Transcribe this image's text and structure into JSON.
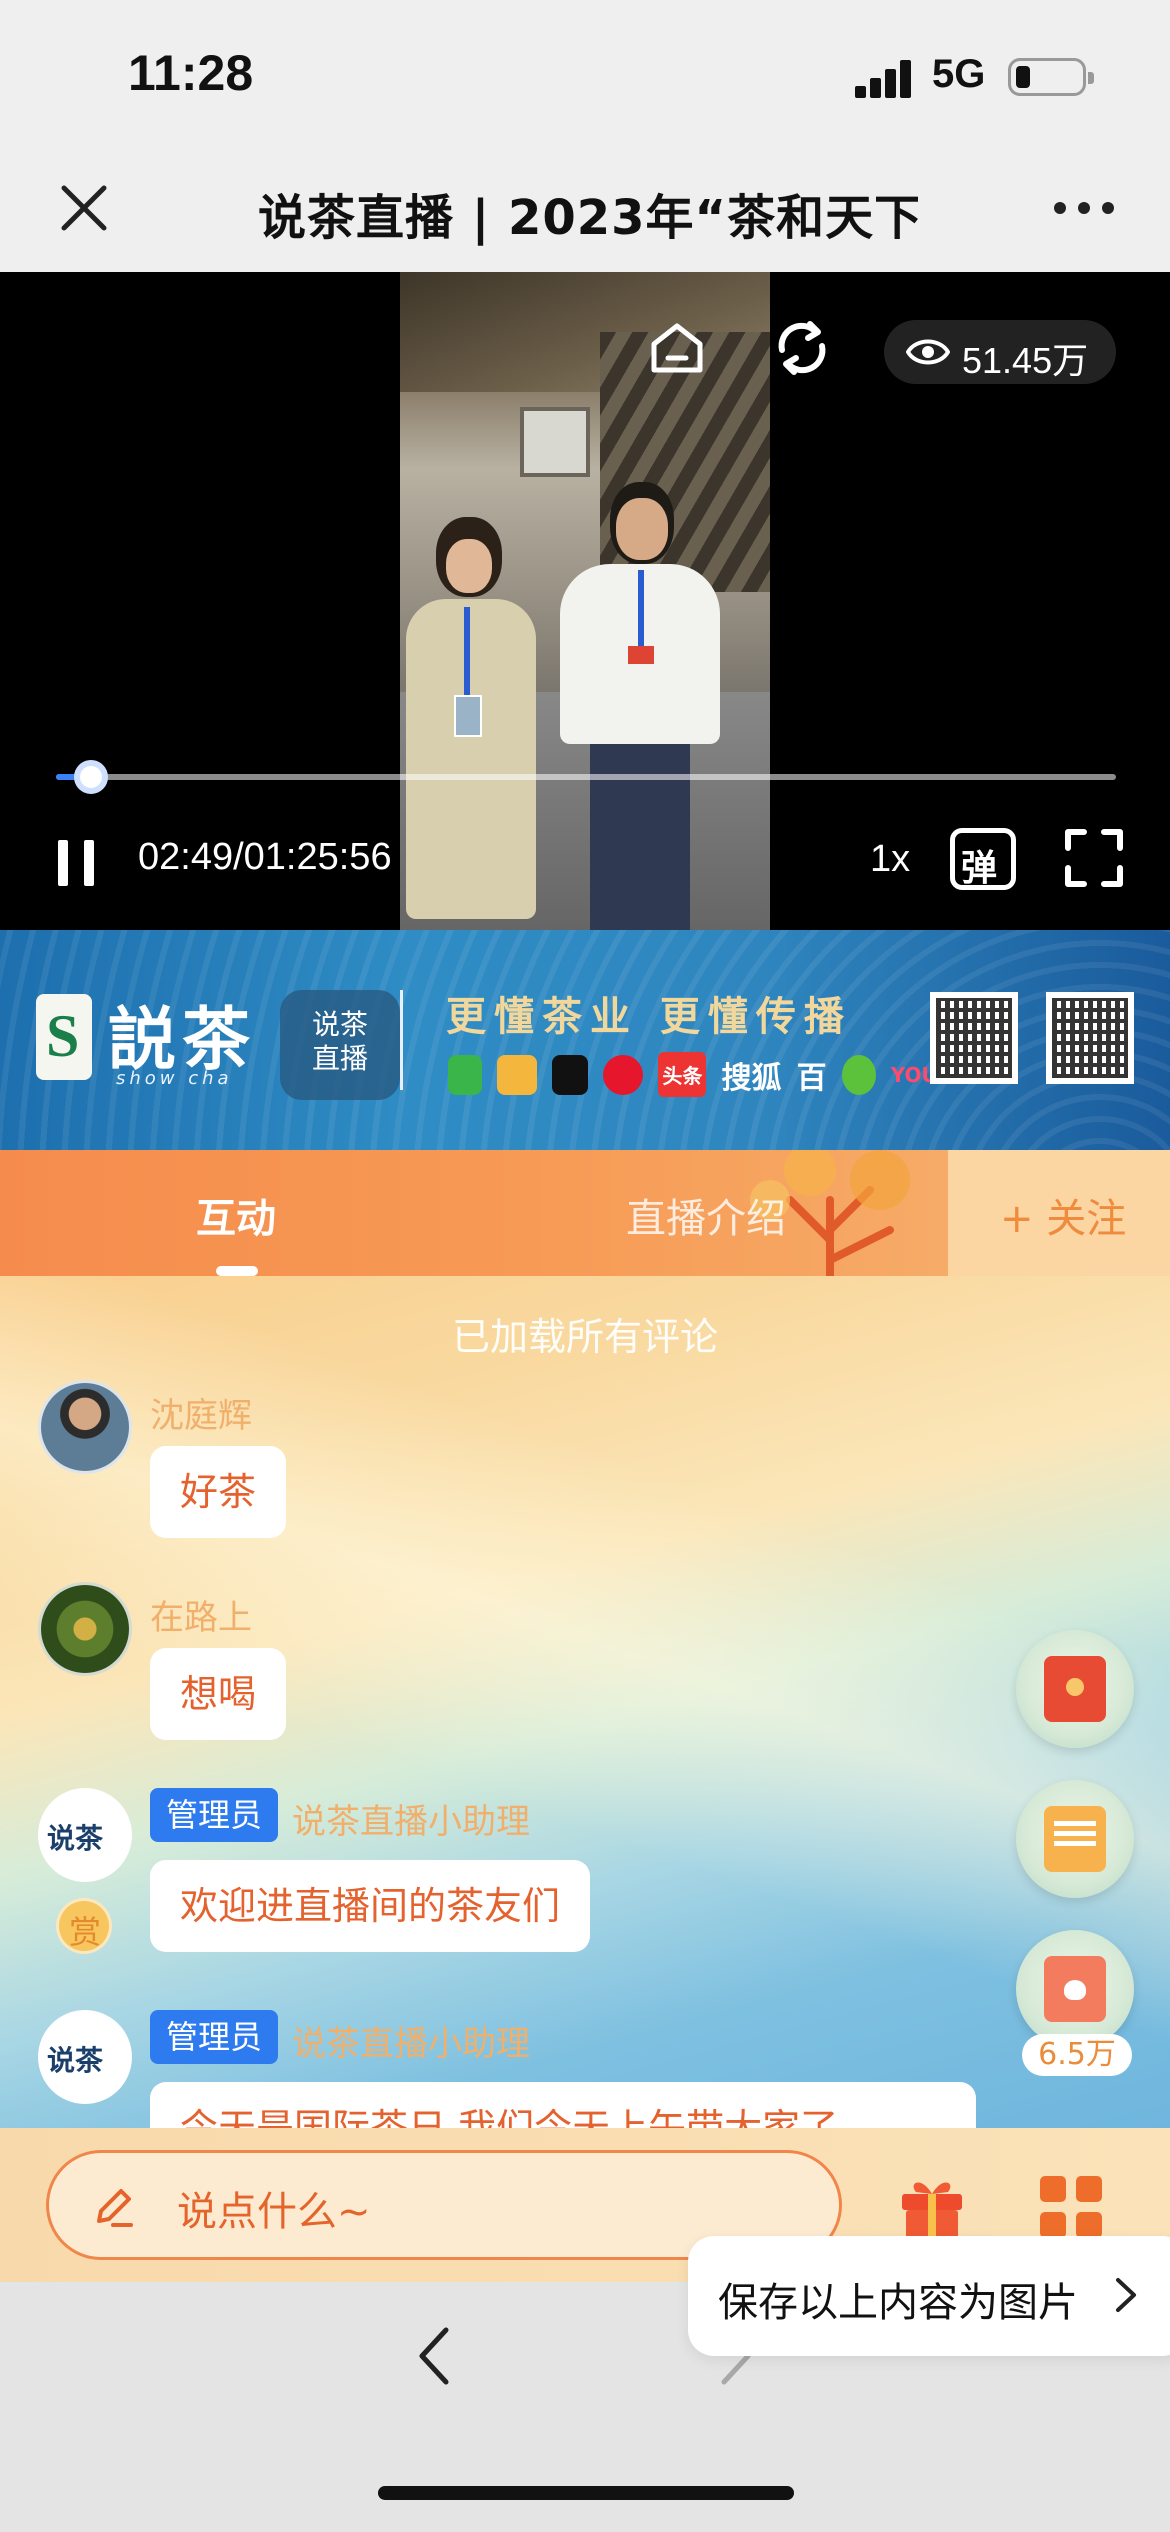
{
  "status_bar": {
    "time": "11:28",
    "network": "5G"
  },
  "navbar": {
    "title": "说茶直播 | 2023年“茶和天下"
  },
  "video": {
    "view_count": "51.45万",
    "current_time": "02:49",
    "separator": "/",
    "duration": "01:25:56",
    "progress_fraction": 0.033,
    "speed_label": "1x",
    "danmu_label": "弹"
  },
  "banner": {
    "brand": "説茶",
    "brand_sub": "show cha",
    "seal_text": "说茶 直播",
    "slogan": "更懂茶业 更懂传播",
    "platform_texts": [
      "头条",
      "搜狐",
      "百",
      "YOUKU"
    ]
  },
  "tabs": {
    "items": [
      {
        "label": "互动",
        "active": true
      },
      {
        "label": "直播介绍",
        "active": false
      }
    ],
    "follow_label": "+ 关注"
  },
  "chat": {
    "loaded_notice": "已加载所有评论",
    "messages": [
      {
        "nickname": "沈庭辉",
        "text": "好茶"
      },
      {
        "nickname": "在路上",
        "text": "想喝"
      },
      {
        "badge": "管理员",
        "nickname": "说茶直播小助理",
        "avatar_text": "说茶",
        "reward": "赏",
        "text": "欢迎进直播间的茶友们"
      },
      {
        "badge": "管理员",
        "nickname": "说茶直播小助理",
        "avatar_text": "说茶",
        "text": "今天是国际茶日 我们今天上午带大家了"
      }
    ],
    "gift_count": "6.5万"
  },
  "input": {
    "placeholder": "说点什么~"
  },
  "tooltip": {
    "save_label": "保存以上内容为图片"
  },
  "colors": {
    "accent_orange": "#f08a3c",
    "admin_badge_blue": "#2e7bef",
    "progress_blue": "#3b82f6"
  }
}
